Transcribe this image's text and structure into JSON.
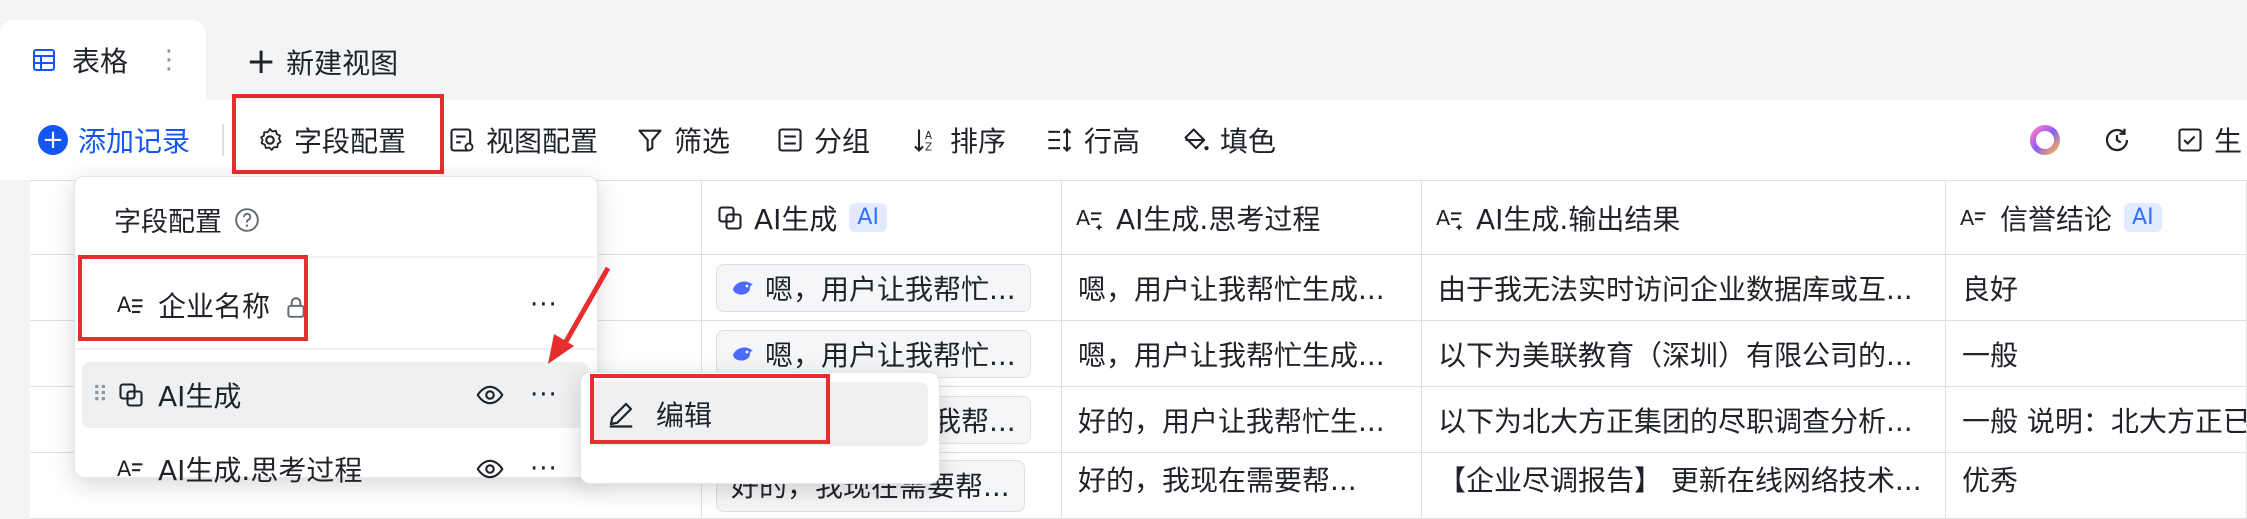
{
  "tabs": {
    "table_label": "表格",
    "more": "⋮",
    "new_view": "新建视图"
  },
  "toolbar": {
    "add_record": "添加记录",
    "field_config": "字段配置",
    "view_config": "视图配置",
    "filter": "筛选",
    "group": "分组",
    "sort": "排序",
    "row_height": "行高",
    "fill_color": "填色",
    "generate_partial": "生"
  },
  "columns": [
    {
      "label": "AI生成",
      "badge": "AI",
      "icon": "ai-generate-icon"
    },
    {
      "label": "AI生成.思考过程",
      "icon": "text-ai-icon"
    },
    {
      "label": "AI生成.输出结果",
      "icon": "text-ai-icon"
    },
    {
      "label": "信誉结论",
      "badge": "AI",
      "icon": "text-ai-icon"
    }
  ],
  "rows": [
    [
      "嗯，用户让我帮忙...",
      "嗯，用户让我帮忙生成...",
      "由于我无法实时访问企业数据库或互...",
      "良好"
    ],
    [
      "嗯，用户让我帮忙...",
      "嗯，用户让我帮忙生成...",
      "以下为美联教育（深圳）有限公司的...",
      "一般"
    ],
    [
      "好的，用户让我帮...",
      "好的，用户让我帮忙生...",
      "以下为北大方正集团的尽职调查分析...",
      "一般 说明：北大方正已"
    ],
    [
      "好的，我现在需要帮...",
      "好的，我现在需要帮...",
      "【企业尽调报告】 更新在线网络技术...",
      "优秀"
    ]
  ],
  "panel": {
    "title": "字段配置",
    "fields": [
      {
        "label": "企业名称",
        "more": "···"
      },
      {
        "label": "AI生成",
        "more": "···"
      },
      {
        "label": "AI生成.思考过程",
        "more": "···"
      }
    ]
  },
  "submenu": {
    "edit": "编辑"
  },
  "colors": {
    "accent": "#1456f0",
    "highlight": "#e62e2e",
    "ai_badge_bg": "#e1eaff",
    "ai_badge_text": "#3370ff"
  }
}
